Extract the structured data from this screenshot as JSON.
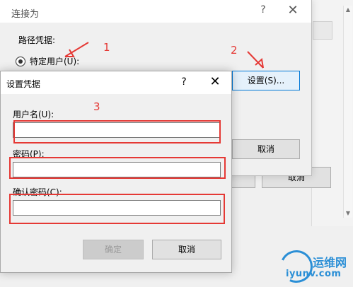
{
  "connect_as": {
    "title": "连接为",
    "help": "?",
    "close": "✕",
    "path_credentials_label": "路径凭据:",
    "specific_user_label": "特定用户(U):",
    "settings_button": "设置(S)...",
    "cancel_button": "取消"
  },
  "background": {
    "cancel_button": "取消"
  },
  "set_credentials": {
    "title": "设置凭据",
    "help": "?",
    "close": "✕",
    "username_label": "用户名(U):",
    "username_value": "",
    "password_label": "密码(P):",
    "password_value": "",
    "confirm_password_label": "确认密码(C):",
    "confirm_password_value": "",
    "ok_button": "确定",
    "cancel_button": "取消"
  },
  "annotations": {
    "step1": "1",
    "step2": "2",
    "step3": "3",
    "color": "#e53935"
  },
  "watermark": {
    "brand": "运维网",
    "domain": "iyunv.com",
    "color": "#2b8fd6"
  }
}
